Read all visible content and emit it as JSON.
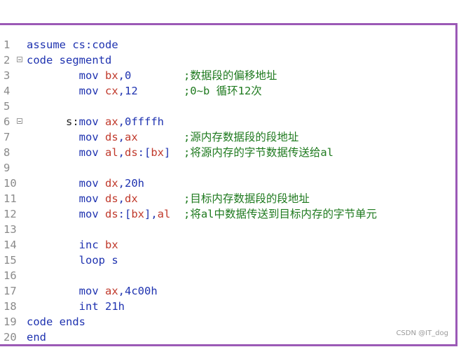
{
  "editor": {
    "lines": [
      {
        "num": "1",
        "parts": [
          {
            "t": "assume cs:code",
            "c": "kw"
          }
        ]
      },
      {
        "num": "2",
        "fold": true,
        "parts": [
          {
            "t": "code segmentd",
            "c": "kw"
          }
        ]
      },
      {
        "num": "3",
        "parts": [
          {
            "t": "        mov ",
            "c": "kw"
          },
          {
            "t": "bx",
            "c": "reg"
          },
          {
            "t": ",0",
            "c": "kw"
          },
          {
            "t": "        ;数据段的偏移地址",
            "c": "cm"
          }
        ]
      },
      {
        "num": "4",
        "parts": [
          {
            "t": "        mov ",
            "c": "kw"
          },
          {
            "t": "cx",
            "c": "reg"
          },
          {
            "t": ",12",
            "c": "kw"
          },
          {
            "t": "       ;0~b 循环12次",
            "c": "cm"
          }
        ]
      },
      {
        "num": "5",
        "parts": []
      },
      {
        "num": "6",
        "fold": true,
        "parts": [
          {
            "t": "      s:",
            "c": "plain"
          },
          {
            "t": "mov ",
            "c": "kw"
          },
          {
            "t": "ax",
            "c": "reg"
          },
          {
            "t": ",0ffffh",
            "c": "kw"
          }
        ]
      },
      {
        "num": "7",
        "parts": [
          {
            "t": "        mov ",
            "c": "kw"
          },
          {
            "t": "ds",
            "c": "reg"
          },
          {
            "t": ",",
            "c": "kw"
          },
          {
            "t": "ax",
            "c": "reg"
          },
          {
            "t": "       ;源内存数据段的段地址",
            "c": "cm"
          }
        ]
      },
      {
        "num": "8",
        "parts": [
          {
            "t": "        mov ",
            "c": "kw"
          },
          {
            "t": "al",
            "c": "reg"
          },
          {
            "t": ",",
            "c": "kw"
          },
          {
            "t": "ds",
            "c": "reg"
          },
          {
            "t": ":[",
            "c": "kw"
          },
          {
            "t": "bx",
            "c": "reg"
          },
          {
            "t": "]",
            "c": "kw"
          },
          {
            "t": "  ;将源内存的字节数据传送给al",
            "c": "cm"
          }
        ]
      },
      {
        "num": "9",
        "parts": []
      },
      {
        "num": "10",
        "parts": [
          {
            "t": "        mov ",
            "c": "kw"
          },
          {
            "t": "dx",
            "c": "reg"
          },
          {
            "t": ",20h",
            "c": "kw"
          }
        ]
      },
      {
        "num": "11",
        "parts": [
          {
            "t": "        mov ",
            "c": "kw"
          },
          {
            "t": "ds",
            "c": "reg"
          },
          {
            "t": ",",
            "c": "kw"
          },
          {
            "t": "dx",
            "c": "reg"
          },
          {
            "t": "       ;目标内存数据段的段地址",
            "c": "cm"
          }
        ]
      },
      {
        "num": "12",
        "parts": [
          {
            "t": "        mov ",
            "c": "kw"
          },
          {
            "t": "ds",
            "c": "reg"
          },
          {
            "t": ":[",
            "c": "kw"
          },
          {
            "t": "bx",
            "c": "reg"
          },
          {
            "t": "],",
            "c": "kw"
          },
          {
            "t": "al",
            "c": "reg"
          },
          {
            "t": "  ;将al中数据传送到目标内存的字节单元",
            "c": "cm"
          }
        ]
      },
      {
        "num": "13",
        "parts": []
      },
      {
        "num": "14",
        "parts": [
          {
            "t": "        inc ",
            "c": "kw"
          },
          {
            "t": "bx",
            "c": "reg"
          }
        ]
      },
      {
        "num": "15",
        "parts": [
          {
            "t": "        loop s",
            "c": "kw"
          }
        ]
      },
      {
        "num": "16",
        "parts": []
      },
      {
        "num": "17",
        "parts": [
          {
            "t": "        mov ",
            "c": "kw"
          },
          {
            "t": "ax",
            "c": "reg"
          },
          {
            "t": ",4c00h",
            "c": "kw"
          }
        ]
      },
      {
        "num": "18",
        "parts": [
          {
            "t": "        int 21h",
            "c": "kw"
          }
        ]
      },
      {
        "num": "19",
        "parts": [
          {
            "t": "code ends",
            "c": "kw"
          }
        ]
      },
      {
        "num": "20",
        "parts": [
          {
            "t": "end",
            "c": "kw"
          }
        ]
      }
    ]
  },
  "watermark": "CSDN @IT_dog"
}
